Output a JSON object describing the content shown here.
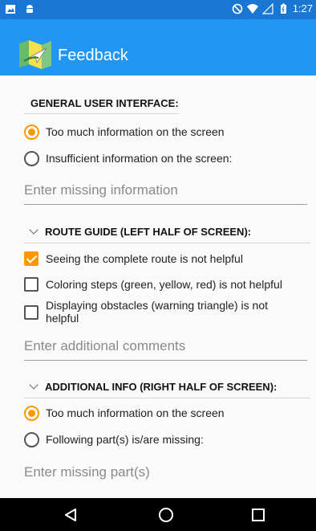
{
  "status_bar": {
    "time": "1:27",
    "left_icons": [
      "image-icon",
      "android-icon"
    ],
    "right_icons": [
      "do-not-disturb-icon",
      "wifi-icon",
      "signal-icon",
      "battery-icon"
    ]
  },
  "app_bar": {
    "title": "Feedback",
    "logo_icon": "map-icon",
    "background": "#2196f3"
  },
  "general": {
    "heading": "GENERAL USER INTERFACE:",
    "options": [
      {
        "label": "Too much information on the screen",
        "selected": true
      },
      {
        "label": "Insufficient information on the screen:",
        "selected": false
      }
    ],
    "input_placeholder": "Enter missing information"
  },
  "route_guide": {
    "heading": "ROUTE GUIDE (LEFT HALF OF SCREEN):",
    "checks": [
      {
        "label": "Seeing the complete route is not helpful",
        "checked": true
      },
      {
        "label": "Coloring steps (green, yellow, red) is not helpful",
        "checked": false
      },
      {
        "label": "Displaying obstacles (warning triangle) is not helpful",
        "checked": false
      }
    ],
    "input_placeholder": "Enter additional comments"
  },
  "additional_info": {
    "heading": "ADDITIONAL INFO (RIGHT HALF OF SCREEN):",
    "options": [
      {
        "label": "Too much information on the screen",
        "selected": true
      },
      {
        "label": "Following part(s) is/are missing:",
        "selected": false
      }
    ],
    "input_placeholder": "Enter missing part(s)"
  },
  "nav_bar": {
    "buttons": [
      "back-icon",
      "home-icon",
      "recents-icon"
    ]
  },
  "colors": {
    "status_bar": "#1976d2",
    "accent": "#ff9800"
  }
}
